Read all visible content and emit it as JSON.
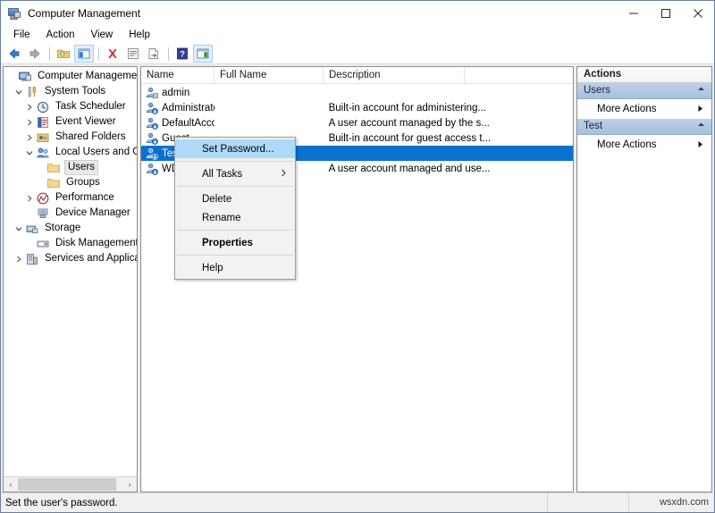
{
  "window": {
    "title": "Computer Management",
    "icon": "computer-management-icon",
    "minimize_label": "—",
    "maximize_label": "□",
    "close_label": "✕"
  },
  "menubar": {
    "items": [
      {
        "label": "File"
      },
      {
        "label": "Action"
      },
      {
        "label": "View"
      },
      {
        "label": "Help"
      }
    ]
  },
  "toolbar": {
    "buttons": [
      {
        "name": "back-icon"
      },
      {
        "name": "forward-icon"
      },
      {
        "name": "separator"
      },
      {
        "name": "up-folder-icon"
      },
      {
        "name": "show-hide-tree-icon"
      },
      {
        "name": "separator"
      },
      {
        "name": "delete-icon"
      },
      {
        "name": "properties-icon"
      },
      {
        "name": "export-list-icon"
      },
      {
        "name": "separator"
      },
      {
        "name": "help-icon"
      },
      {
        "name": "show-action-pane-icon"
      }
    ]
  },
  "tree": {
    "items": [
      {
        "label": "Computer Management (Local",
        "icon": "computer-icon",
        "indent": 0,
        "twisty": "none",
        "selected": false
      },
      {
        "label": "System Tools",
        "icon": "tools-icon",
        "indent": 1,
        "twisty": "expanded",
        "selected": false
      },
      {
        "label": "Task Scheduler",
        "icon": "clock-icon",
        "indent": 2,
        "twisty": "collapsed",
        "selected": false
      },
      {
        "label": "Event Viewer",
        "icon": "event-icon",
        "indent": 2,
        "twisty": "collapsed",
        "selected": false
      },
      {
        "label": "Shared Folders",
        "icon": "shared-folder-icon",
        "indent": 2,
        "twisty": "collapsed",
        "selected": false
      },
      {
        "label": "Local Users and Groups",
        "icon": "users-group-icon",
        "indent": 2,
        "twisty": "expanded",
        "selected": false
      },
      {
        "label": "Users",
        "icon": "folder-icon",
        "indent": 3,
        "twisty": "none",
        "selected": true
      },
      {
        "label": "Groups",
        "icon": "folder-icon",
        "indent": 3,
        "twisty": "none",
        "selected": false
      },
      {
        "label": "Performance",
        "icon": "performance-icon",
        "indent": 2,
        "twisty": "collapsed",
        "selected": false
      },
      {
        "label": "Device Manager",
        "icon": "device-manager-icon",
        "indent": 2,
        "twisty": "none",
        "selected": false
      },
      {
        "label": "Storage",
        "icon": "storage-icon",
        "indent": 1,
        "twisty": "expanded",
        "selected": false
      },
      {
        "label": "Disk Management",
        "icon": "disk-icon",
        "indent": 2,
        "twisty": "none",
        "selected": false
      },
      {
        "label": "Services and Applications",
        "icon": "services-icon",
        "indent": 1,
        "twisty": "collapsed",
        "selected": false
      }
    ],
    "hscroll": {
      "left_arrow": "‹",
      "right_arrow": "›"
    }
  },
  "list": {
    "columns": [
      {
        "label": "Name"
      },
      {
        "label": "Full Name"
      },
      {
        "label": "Description"
      }
    ],
    "rows": [
      {
        "name": "admin",
        "full_name": "",
        "description": "",
        "selected": false,
        "icon": "user-icon"
      },
      {
        "name": "Administrator",
        "full_name": "",
        "description": "Built-in account for administering...",
        "selected": false,
        "icon": "user-icon"
      },
      {
        "name": "DefaultAcco",
        "full_name": "",
        "description": "A user account managed by the s...",
        "selected": false,
        "icon": "user-icon"
      },
      {
        "name": "Guest",
        "full_name": "",
        "description": "Built-in account for guest access t...",
        "selected": false,
        "icon": "user-icon"
      },
      {
        "name": "Test",
        "full_name": "",
        "description": "",
        "selected": true,
        "icon": "user-icon"
      },
      {
        "name": "WD",
        "full_name": "",
        "description": "A user account managed and use...",
        "selected": false,
        "icon": "user-icon"
      }
    ]
  },
  "context_menu": {
    "items": [
      {
        "label": "Set Password...",
        "highlight": true,
        "bold": false,
        "submenu": false
      },
      {
        "separator": true
      },
      {
        "label": "All Tasks",
        "highlight": false,
        "bold": false,
        "submenu": true
      },
      {
        "separator": true
      },
      {
        "label": "Delete",
        "highlight": false,
        "bold": false,
        "submenu": false
      },
      {
        "label": "Rename",
        "highlight": false,
        "bold": false,
        "submenu": false
      },
      {
        "separator": true
      },
      {
        "label": "Properties",
        "highlight": false,
        "bold": true,
        "submenu": false
      },
      {
        "separator": true
      },
      {
        "label": "Help",
        "highlight": false,
        "bold": false,
        "submenu": false
      }
    ],
    "submenu_arrow": "›"
  },
  "actions": {
    "title": "Actions",
    "groups": [
      {
        "header": "Users",
        "collapse_icon": "chevron-up-icon",
        "items": [
          {
            "label": "More Actions",
            "arrow": "▶"
          }
        ]
      },
      {
        "header": "Test",
        "collapse_icon": "chevron-up-icon",
        "items": [
          {
            "label": "More Actions",
            "arrow": "▶"
          }
        ]
      }
    ]
  },
  "statusbar": {
    "message": "Set the user's password.",
    "watermark": "wsxdn.com"
  },
  "colors": {
    "selection_blue": "#0b71ce",
    "menu_highlight": "#addaf7",
    "actions_header": "#a8c0de",
    "window_border": "#6b7f9e"
  }
}
